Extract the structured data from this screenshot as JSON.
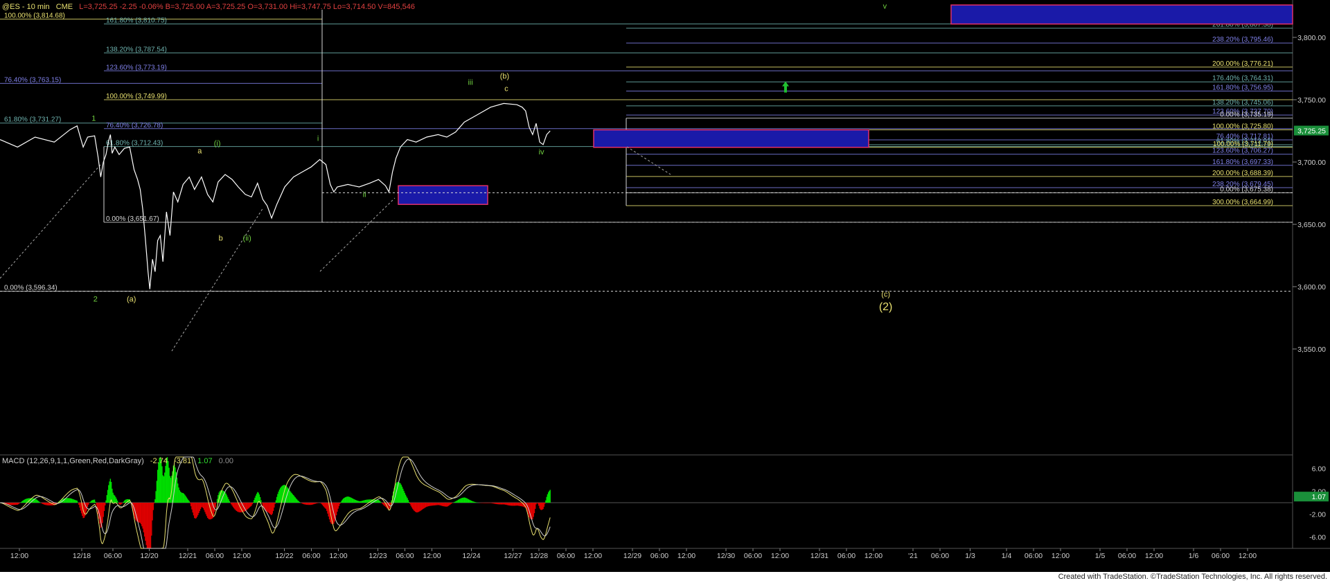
{
  "header": {
    "symbol": "@ES - 10 min",
    "exchange": "CME",
    "quote": "L=3,725.25 -2.25 -0.06% B=3,725.00 A=3,725.25 O=3,731.00 Hi=3,747.75 Lo=3,714.50 V=845,546"
  },
  "footer": {
    "credit": "Created with TradeStation. ©TradeStation Technologies, Inc. All rights reserved."
  },
  "colors": {
    "background": "#000000",
    "price": "#ffffff",
    "last_price_tag": "#1a8f3a",
    "fib_yellow": "#e8e070",
    "fib_blue": "#7f80e8",
    "fib_teal": "#6fb4b0",
    "fib_white": "#d8d8d8",
    "box_blue": "#1a1aa8",
    "box_red": "#e0306a",
    "macd_up": "#00e000",
    "macd_down": "#e00000",
    "wave_green": "#70d040",
    "wave_yellow": "#e8e070",
    "arrow": "#20c030"
  },
  "chart_data": [
    {
      "type": "line",
      "name": "price",
      "ylim": [
        3530,
        3830
      ],
      "y_ticks": [
        {
          "label": "3,800.00",
          "value": 3800
        },
        {
          "label": "3,750.00",
          "value": 3750
        },
        {
          "label": "3,700.00",
          "value": 3700
        },
        {
          "label": "3,650.00",
          "value": 3650
        },
        {
          "label": "3,600.00",
          "value": 3600
        },
        {
          "label": "3,550.00",
          "value": 3550
        }
      ],
      "x_ticks": [
        "12:00",
        "12/18",
        "06:00",
        "12/20",
        "12/21",
        "06:00",
        "12:00",
        "12/22",
        "06:00",
        "12:00",
        "12/23",
        "06:00",
        "12:00",
        "12/24",
        "12/27",
        "12/28",
        "06:00",
        "12:00",
        "12/29",
        "06:00",
        "12:00",
        "12/30",
        "06:00",
        "12:00",
        "12/31",
        "06:00",
        "12:00",
        "'21",
        "06:00",
        "1/3",
        "1/4",
        "06:00",
        "12:00",
        "1/5",
        "06:00",
        "12:00",
        "1/6",
        "06:00",
        "12:00"
      ],
      "x_tick_index": [
        0,
        60,
        90,
        125,
        162,
        188,
        214,
        255,
        281,
        307,
        345,
        371,
        397,
        435,
        475,
        500,
        526,
        552,
        590,
        616,
        642,
        680,
        706,
        732,
        770,
        796,
        822,
        860,
        886,
        915,
        950,
        976,
        1002,
        1040,
        1066,
        1092,
        1130,
        1156,
        1182
      ],
      "last_price": {
        "label": "3,725.25",
        "value": 3725.25
      },
      "price_points": [
        [
          0,
          3718
        ],
        [
          20,
          3712
        ],
        [
          40,
          3720
        ],
        [
          62,
          3716
        ],
        [
          80,
          3726
        ],
        [
          88,
          3729
        ],
        [
          95,
          3712
        ],
        [
          100,
          3720
        ],
        [
          108,
          3721
        ],
        [
          112,
          3704
        ],
        [
          115,
          3688
        ],
        [
          118,
          3700
        ],
        [
          121,
          3706
        ],
        [
          124,
          3717
        ],
        [
          126,
          3722
        ],
        [
          128,
          3707
        ],
        [
          131,
          3712
        ],
        [
          136,
          3706
        ],
        [
          142,
          3711
        ],
        [
          148,
          3712
        ],
        [
          153,
          3694
        ],
        [
          157,
          3686
        ],
        [
          160,
          3678
        ],
        [
          163,
          3662
        ],
        [
          166,
          3638
        ],
        [
          169,
          3612
        ],
        [
          171,
          3598
        ],
        [
          174,
          3622
        ],
        [
          177,
          3612
        ],
        [
          180,
          3637
        ],
        [
          183,
          3641
        ],
        [
          186,
          3620
        ],
        [
          190,
          3660
        ],
        [
          194,
          3641
        ],
        [
          198,
          3676
        ],
        [
          203,
          3668
        ],
        [
          209,
          3682
        ],
        [
          216,
          3688
        ],
        [
          222,
          3678
        ],
        [
          230,
          3688
        ],
        [
          237,
          3674
        ],
        [
          243,
          3668
        ],
        [
          249,
          3684
        ],
        [
          257,
          3690
        ],
        [
          265,
          3686
        ],
        [
          272,
          3680
        ],
        [
          280,
          3674
        ],
        [
          287,
          3672
        ],
        [
          294,
          3683
        ],
        [
          300,
          3670
        ],
        [
          305,
          3665
        ],
        [
          310,
          3655
        ],
        [
          316,
          3666
        ],
        [
          325,
          3680
        ],
        [
          335,
          3688
        ],
        [
          345,
          3692
        ],
        [
          355,
          3696
        ],
        [
          365,
          3702
        ],
        [
          372,
          3698
        ],
        [
          377,
          3682
        ],
        [
          381,
          3676
        ],
        [
          385,
          3680
        ],
        [
          397,
          3682
        ],
        [
          410,
          3680
        ],
        [
          422,
          3683
        ],
        [
          432,
          3686
        ],
        [
          440,
          3681
        ],
        [
          444,
          3676
        ],
        [
          448,
          3692
        ],
        [
          452,
          3703
        ],
        [
          457,
          3712
        ],
        [
          465,
          3718
        ],
        [
          475,
          3716
        ],
        [
          487,
          3720
        ],
        [
          500,
          3722
        ],
        [
          510,
          3720
        ],
        [
          520,
          3724
        ],
        [
          530,
          3732
        ],
        [
          545,
          3738
        ],
        [
          560,
          3744
        ],
        [
          575,
          3747
        ],
        [
          590,
          3746
        ],
        [
          596,
          3744
        ],
        [
          600,
          3741
        ],
        [
          604,
          3728
        ],
        [
          608,
          3722
        ],
        [
          612,
          3731
        ],
        [
          616,
          3716
        ],
        [
          620,
          3714
        ],
        [
          624,
          3722
        ],
        [
          628,
          3725
        ]
      ],
      "annotations": [
        {
          "label": "a",
          "color": "#e8e070",
          "x": 228,
          "y": 3707
        },
        {
          "label": "b",
          "color": "#e8e070",
          "x": 252,
          "y": 3637
        },
        {
          "label": "(i)",
          "color": "#70d040",
          "x": 248,
          "y": 3713
        },
        {
          "label": "(ii)",
          "color": "#70d040",
          "x": 282,
          "y": 3637
        },
        {
          "label": "i",
          "color": "#70d040",
          "x": 363,
          "y": 3717
        },
        {
          "label": "ii",
          "color": "#70d040",
          "x": 416,
          "y": 3672
        },
        {
          "label": "iii",
          "color": "#70d040",
          "x": 537,
          "y": 3762
        },
        {
          "label": "(b)",
          "color": "#e8e070",
          "x": 576,
          "y": 3767
        },
        {
          "label": "c",
          "color": "#e8e070",
          "x": 578,
          "y": 3757
        },
        {
          "label": "iv",
          "color": "#70d040",
          "x": 618,
          "y": 3706
        },
        {
          "label": "1",
          "color": "#70d040",
          "x": 107,
          "y": 3733
        },
        {
          "label": "2",
          "color": "#70d040",
          "x": 109,
          "y": 3588
        },
        {
          "label": "(a)",
          "color": "#e8e070",
          "x": 150,
          "y": 3588
        },
        {
          "label": "v",
          "color": "#70d040",
          "x": 1010,
          "y": 3823
        },
        {
          "label": "(c)",
          "color": "#e8e070",
          "x": 1011,
          "y": 3592
        },
        {
          "label": "(2)",
          "color": "#e8e070",
          "x": 1011,
          "y": 3581
        }
      ],
      "fib_labels": [
        {
          "label": "100.00% (3,814.68)",
          "value": 3814.68,
          "x": 0,
          "color": "#e8e070"
        },
        {
          "label": "161.80% (3,810.75)",
          "value": 3810.75,
          "x": 96,
          "color": "#6fb4b0"
        },
        {
          "label": "138.20% (3,787.54)",
          "value": 3787.54,
          "x": 96,
          "color": "#6fb4b0"
        },
        {
          "label": "123.60% (3,773.19)",
          "value": 3773.19,
          "x": 96,
          "color": "#7f80e8"
        },
        {
          "label": "76.40% (3,763.15)",
          "value": 3763.15,
          "x": 0,
          "color": "#7f80e8"
        },
        {
          "label": "100.00% (3,749.99)",
          "value": 3749.99,
          "x": 96,
          "color": "#e8e070"
        },
        {
          "label": "61.80% (3,731.27)",
          "value": 3731.27,
          "x": 0,
          "color": "#6fb4b0"
        },
        {
          "label": "76.40% (3,726.78)",
          "value": 3726.78,
          "x": 96,
          "color": "#7f80e8"
        },
        {
          "label": "61.80% (3,712.43)",
          "value": 3712.43,
          "x": 96,
          "color": "#6fb4b0"
        },
        {
          "label": "0.00% (3,651.67)",
          "value": 3651.67,
          "x": 96,
          "color": "#d8d8d8"
        },
        {
          "label": "0.00% (3,596.34)",
          "value": 3596.34,
          "x": 0,
          "color": "#d8d8d8"
        },
        {
          "label": "261.80% (3,807.38)",
          "value": 3807.38,
          "x": 1188,
          "color": "#6fb4b0"
        },
        {
          "label": "238.20% (3,795.46)",
          "value": 3795.46,
          "x": 1188,
          "color": "#7f80e8"
        },
        {
          "label": "200.00% (3,776.21)",
          "value": 3776.21,
          "x": 1188,
          "color": "#e8e070"
        },
        {
          "label": "176.40% (3,764.31)",
          "value": 3764.31,
          "x": 1188,
          "color": "#6fb4b0"
        },
        {
          "label": "161.80% (3,756.95)",
          "value": 3756.95,
          "x": 1188,
          "color": "#7f80e8"
        },
        {
          "label": "138.20% (3,745.06)",
          "value": 3745.06,
          "x": 1188,
          "color": "#6fb4b0"
        },
        {
          "label": "123.60% (3,737.70)",
          "value": 3737.7,
          "x": 1188,
          "color": "#7f80e8"
        },
        {
          "label": "0.00% (3,735.19)",
          "value": 3735.19,
          "x": 1188,
          "color": "#d8d8d8"
        },
        {
          "label": "100.00% (3,725.80)",
          "value": 3725.8,
          "x": 1188,
          "color": "#e8e070"
        },
        {
          "label": "76.40% (3,717.81)",
          "value": 3717.81,
          "x": 1188,
          "color": "#7f80e8"
        },
        {
          "label": "61.80% (3,713.91)",
          "value": 3713.91,
          "x": 1188,
          "color": "#6fb4b0"
        },
        {
          "label": "100.00% (3,711.79)",
          "value": 3711.79,
          "x": 1188,
          "color": "#e8e070"
        },
        {
          "label": "123.60% (3,706.27)",
          "value": 3706.27,
          "x": 1188,
          "color": "#7f80e8"
        },
        {
          "label": "161.80% (3,697.33)",
          "value": 3697.33,
          "x": 1188,
          "color": "#7f80e8"
        },
        {
          "label": "200.00% (3,688.39)",
          "value": 3688.39,
          "x": 1188,
          "color": "#e8e070"
        },
        {
          "label": "238.20% (3,679.45)",
          "value": 3679.45,
          "x": 1188,
          "color": "#7f80e8"
        },
        {
          "label": "0.00% (3,675.38)",
          "value": 3675.38,
          "x": 1188,
          "color": "#d8d8d8"
        },
        {
          "label": "300.00% (3,664.99)",
          "value": 3664.99,
          "x": 1188,
          "color": "#e8e070"
        }
      ]
    },
    {
      "type": "area",
      "name": "MACD",
      "title": "MACD (12,26,9,1,1,Green,Red,DarkGray)",
      "readings": [
        "-2.74",
        "-3.81",
        "1.07",
        "0.00"
      ],
      "ylim": [
        -8,
        8
      ],
      "y_ticks": [
        {
          "label": "6.00",
          "value": 6
        },
        {
          "label": "2.00",
          "value": 2
        },
        {
          "label": "-2.00",
          "value": -2
        },
        {
          "label": "-6.00",
          "value": -6
        }
      ],
      "last_value": {
        "label": "1.07",
        "value": 1.07
      }
    }
  ]
}
